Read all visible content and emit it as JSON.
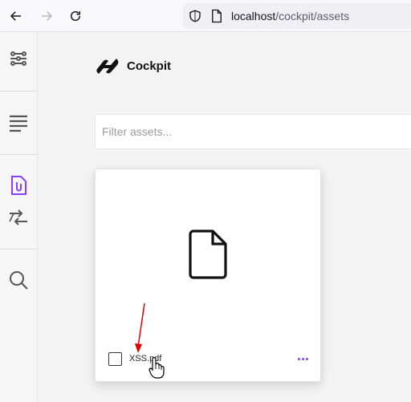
{
  "browser": {
    "url_host": "localhost",
    "url_path": "/cockpit/assets",
    "icons": [
      "back-arrow-icon",
      "forward-arrow-icon",
      "reload-icon",
      "shield-icon",
      "page-icon"
    ]
  },
  "sidebar": {
    "items": [
      {
        "name": "sidebar-item-dashboard",
        "icon": "grid-nodes-icon"
      },
      {
        "name": "sidebar-item-content",
        "icon": "menu-lines-icon"
      },
      {
        "name": "sidebar-item-assets",
        "icon": "attachment-file-icon",
        "active": true
      },
      {
        "name": "sidebar-item-sync",
        "icon": "swap-arrows-icon"
      },
      {
        "name": "sidebar-item-search",
        "icon": "search-icon"
      }
    ],
    "active_color": "#8a3ffc"
  },
  "app": {
    "brand": "Cockpit"
  },
  "filter": {
    "placeholder": "Filter assets..."
  },
  "assets": [
    {
      "file_name": "XSS.pdf",
      "icon": "document-icon"
    }
  ],
  "colors": {
    "accent": "#8a3ffc",
    "annotation_arrow": "#e00000"
  }
}
